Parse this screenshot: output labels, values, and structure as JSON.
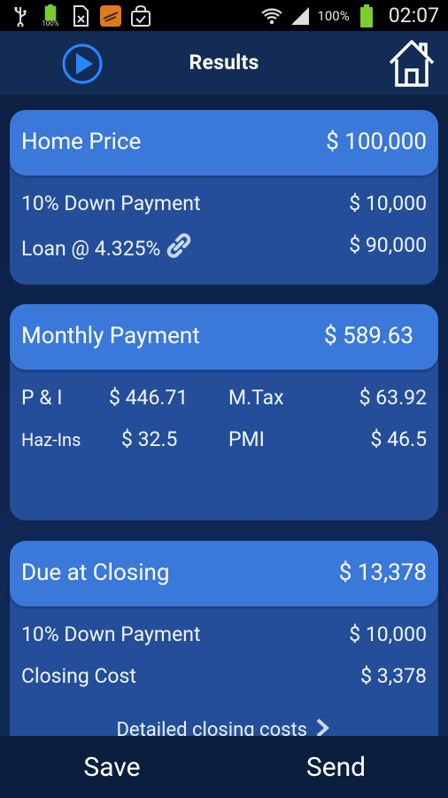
{
  "status_bar": {
    "battery_small": "100%",
    "battery_percent": "100%",
    "time": "02:07"
  },
  "header": {
    "title": "Results",
    "icons": [
      "play-icon",
      "home-icon"
    ]
  },
  "home_price_card": {
    "label": "Home Price",
    "value": "$ 100,000",
    "rows": [
      {
        "label": "10% Down Payment",
        "value": "$ 10,000"
      },
      {
        "label": "Loan @ 4.325%",
        "value": "$ 90,000"
      }
    ]
  },
  "monthly_card": {
    "label": "Monthly Payment",
    "value": "$ 589.63",
    "pi_label": "P & I",
    "pi_value": "$ 446.71",
    "tax_label": "M.Tax",
    "tax_value": "$ 63.92",
    "haz_label": "Haz-Ins",
    "haz_value": "$ 32.5",
    "pmi_label": "PMI",
    "pmi_value": "$ 46.5"
  },
  "closing_card": {
    "label": "Due at Closing",
    "value": "$ 13,378",
    "rows": [
      {
        "label": "10% Down Payment",
        "value": "$ 10,000"
      },
      {
        "label": "Closing Cost",
        "value": "$ 3,378"
      }
    ],
    "detail_link": "Detailed closing costs"
  },
  "bottom_bar": {
    "save": "Save",
    "send": "Send"
  },
  "colors": {
    "accent": "#3a78da",
    "card": "#244e99",
    "background": "#0e2348"
  }
}
